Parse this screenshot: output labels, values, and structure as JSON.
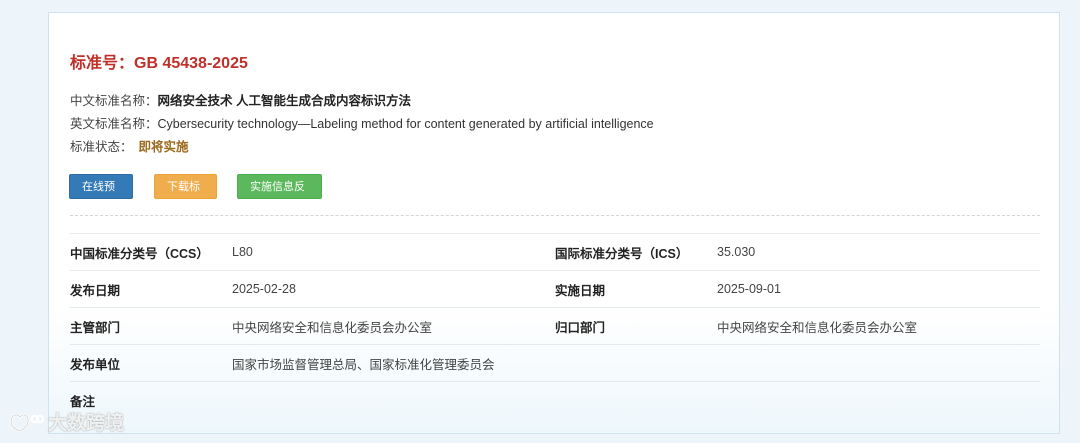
{
  "standard": {
    "title": "标准号：GB 45438-2025",
    "cn_name_label": "中文标准名称：",
    "cn_name": "网络安全技术 人工智能生成合成内容标识方法",
    "en_name_label": "英文标准名称：",
    "en_name": "Cybersecurity technology—Labeling method for content generated by artificial intelligence",
    "status_label": "标准状态：",
    "status": "即将实施"
  },
  "buttons": {
    "preview": "在线预览",
    "download": "下载标准",
    "feedback": "实施信息反馈"
  },
  "details": [
    {
      "label1": "中国标准分类号（CCS）",
      "value1": "L80",
      "label2": "国际标准分类号（ICS）",
      "value2": "35.030"
    },
    {
      "label1": "发布日期",
      "value1": "2025-02-28",
      "label2": "实施日期",
      "value2": "2025-09-01"
    },
    {
      "label1": "主管部门",
      "value1": "中央网络安全和信息化委员会办公室",
      "label2": "归口部门",
      "value2": "中央网络安全和信息化委员会办公室"
    },
    {
      "label1": "发布单位",
      "value1": "国家市场监督管理总局、国家标准化管理委员会",
      "label2": "",
      "value2": ""
    },
    {
      "label1": "备注",
      "value1": "",
      "label2": "",
      "value2": ""
    }
  ],
  "watermark": "大数跨境",
  "colors": {
    "title": "#c0302a",
    "status": "#9c6a1d",
    "btn_preview": "#337ab7",
    "btn_download": "#f0ad4e",
    "btn_feedback": "#5cb85c"
  }
}
